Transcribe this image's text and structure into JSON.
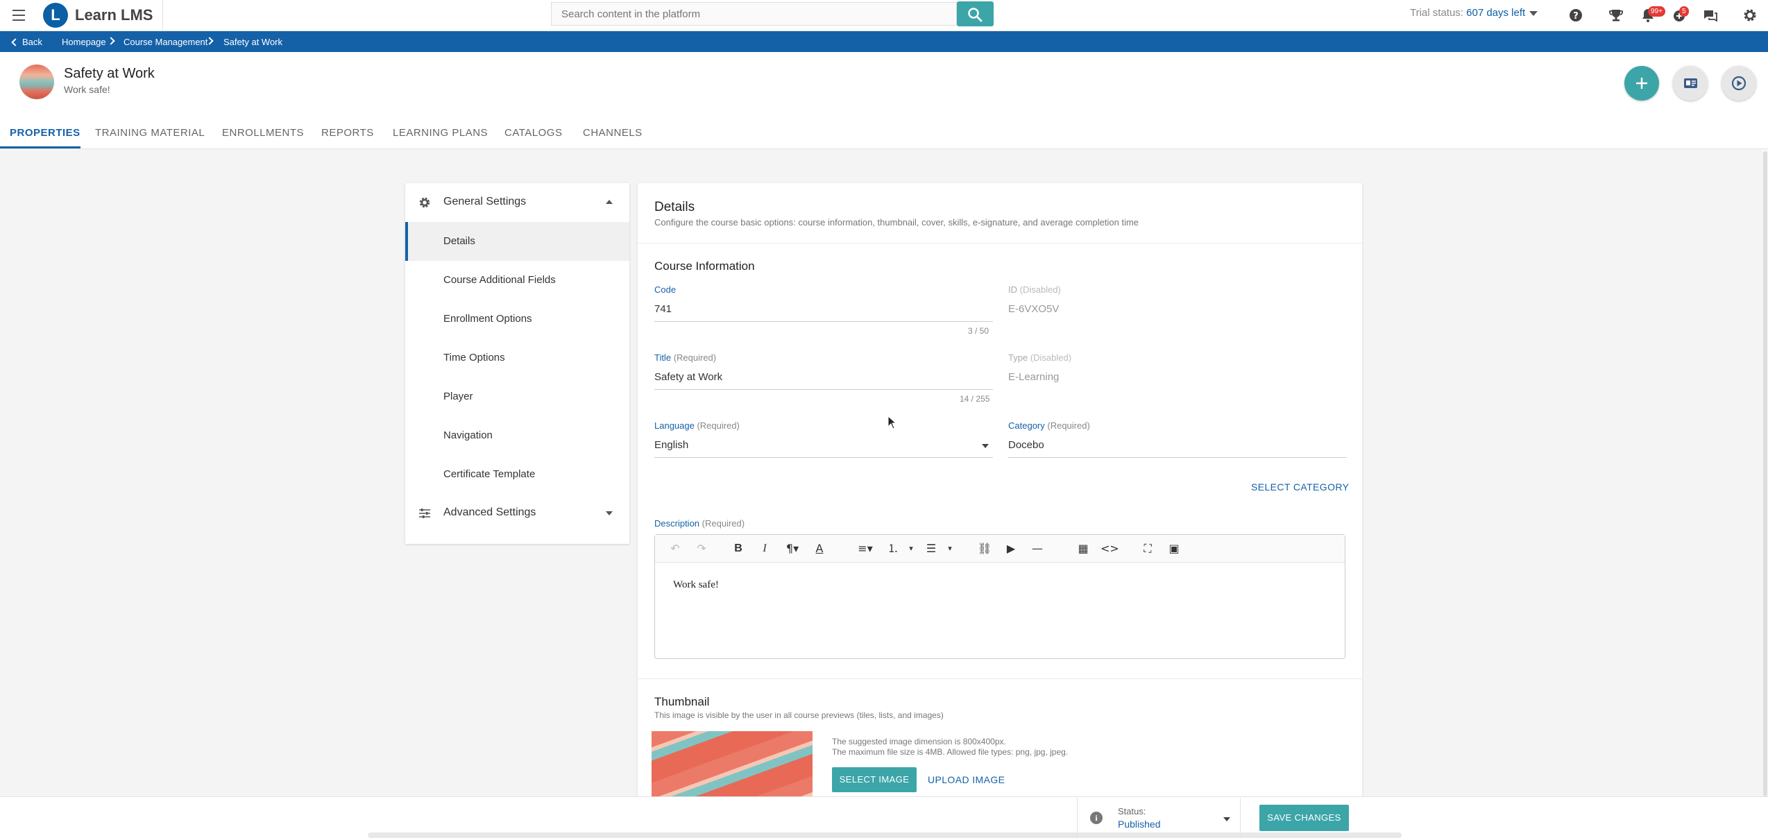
{
  "app": {
    "name": "Learn LMS",
    "logo_letter": "L"
  },
  "search": {
    "placeholder": "Search content in the platform"
  },
  "trial": {
    "prefix": "Trial status:",
    "days": "607 days left"
  },
  "topbar_icons": [
    {
      "name": "help-icon"
    },
    {
      "name": "trophy-icon"
    },
    {
      "name": "notifications-icon",
      "badge": "99+"
    },
    {
      "name": "gamification-icon",
      "badge": "5"
    },
    {
      "name": "messages-icon"
    },
    {
      "name": "settings-icon"
    }
  ],
  "breadcrumb": {
    "back": "Back",
    "items": [
      "Homepage",
      "Course Management",
      "Safety at Work"
    ]
  },
  "course": {
    "title": "Safety at Work",
    "subtitle": "Work safe!"
  },
  "tabs": [
    "PROPERTIES",
    "TRAINING MATERIAL",
    "ENROLLMENTS",
    "REPORTS",
    "LEARNING PLANS",
    "CATALOGS",
    "CHANNELS"
  ],
  "active_tab": "PROPERTIES",
  "sidebar": {
    "general": "General Settings",
    "items": [
      "Details",
      "Course Additional Fields",
      "Enrollment Options",
      "Time Options",
      "Player",
      "Navigation",
      "Certificate Template"
    ],
    "active_item": "Details",
    "advanced": "Advanced Settings"
  },
  "details": {
    "title": "Details",
    "description": "Configure the course basic options: course information, thumbnail, cover, skills, e-signature, and average completion time",
    "section": "Course Information",
    "code": {
      "label": "Code",
      "value": "741",
      "count": "3 / 50"
    },
    "id": {
      "label": "ID",
      "hint": "(Disabled)",
      "value": "E-6VXO5V"
    },
    "title_field": {
      "label": "Title",
      "hint": "(Required)",
      "value": "Safety at Work",
      "count": "14 / 255"
    },
    "type": {
      "label": "Type",
      "hint": "(Disabled)",
      "value": "E-Learning"
    },
    "language": {
      "label": "Language",
      "hint": "(Required)",
      "value": "English"
    },
    "category": {
      "label": "Category",
      "hint": "(Required)",
      "value": "Docebo"
    },
    "select_category": "SELECT CATEGORY",
    "description_field": {
      "label": "Description",
      "hint": "(Required)",
      "content": "Work safe!"
    }
  },
  "thumbnail": {
    "title": "Thumbnail",
    "subtitle": "This image is visible by the user in all course previews (tiles, lists, and images)",
    "hint1": "The suggested image dimension is 800x400px.",
    "hint2": "The maximum file size is 4MB. Allowed file types: png, jpg, jpeg.",
    "select_image": "SELECT IMAGE",
    "upload_image": "UPLOAD IMAGE"
  },
  "footer": {
    "status_label": "Status:",
    "status_value": "Published",
    "save": "SAVE CHANGES"
  },
  "colors": {
    "brand_blue": "#1561a8",
    "accent_teal": "#3ca5a8",
    "badge_red": "#e53935"
  }
}
